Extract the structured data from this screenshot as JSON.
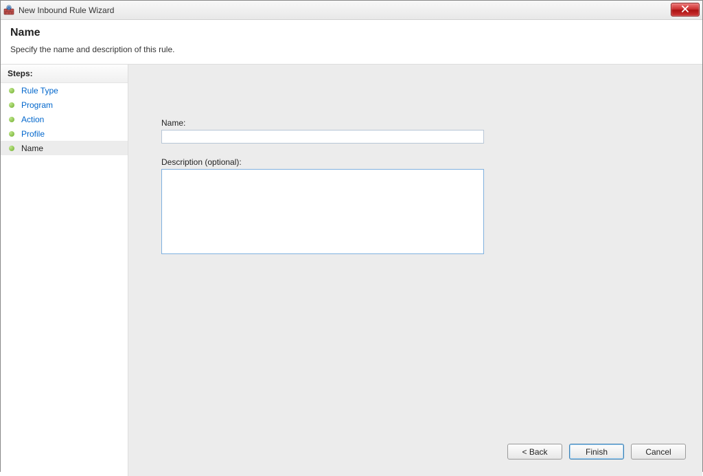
{
  "window": {
    "title": "New Inbound Rule Wizard"
  },
  "header": {
    "title": "Name",
    "subtitle": "Specify the name and description of this rule."
  },
  "sidebar": {
    "steps_label": "Steps:",
    "steps": [
      {
        "label": "Rule Type",
        "state": "completed"
      },
      {
        "label": "Program",
        "state": "completed"
      },
      {
        "label": "Action",
        "state": "completed"
      },
      {
        "label": "Profile",
        "state": "completed"
      },
      {
        "label": "Name",
        "state": "current"
      }
    ]
  },
  "form": {
    "name_label": "Name:",
    "name_value": "",
    "description_label": "Description (optional):",
    "description_value": ""
  },
  "buttons": {
    "back": "< Back",
    "finish": "Finish",
    "cancel": "Cancel"
  }
}
